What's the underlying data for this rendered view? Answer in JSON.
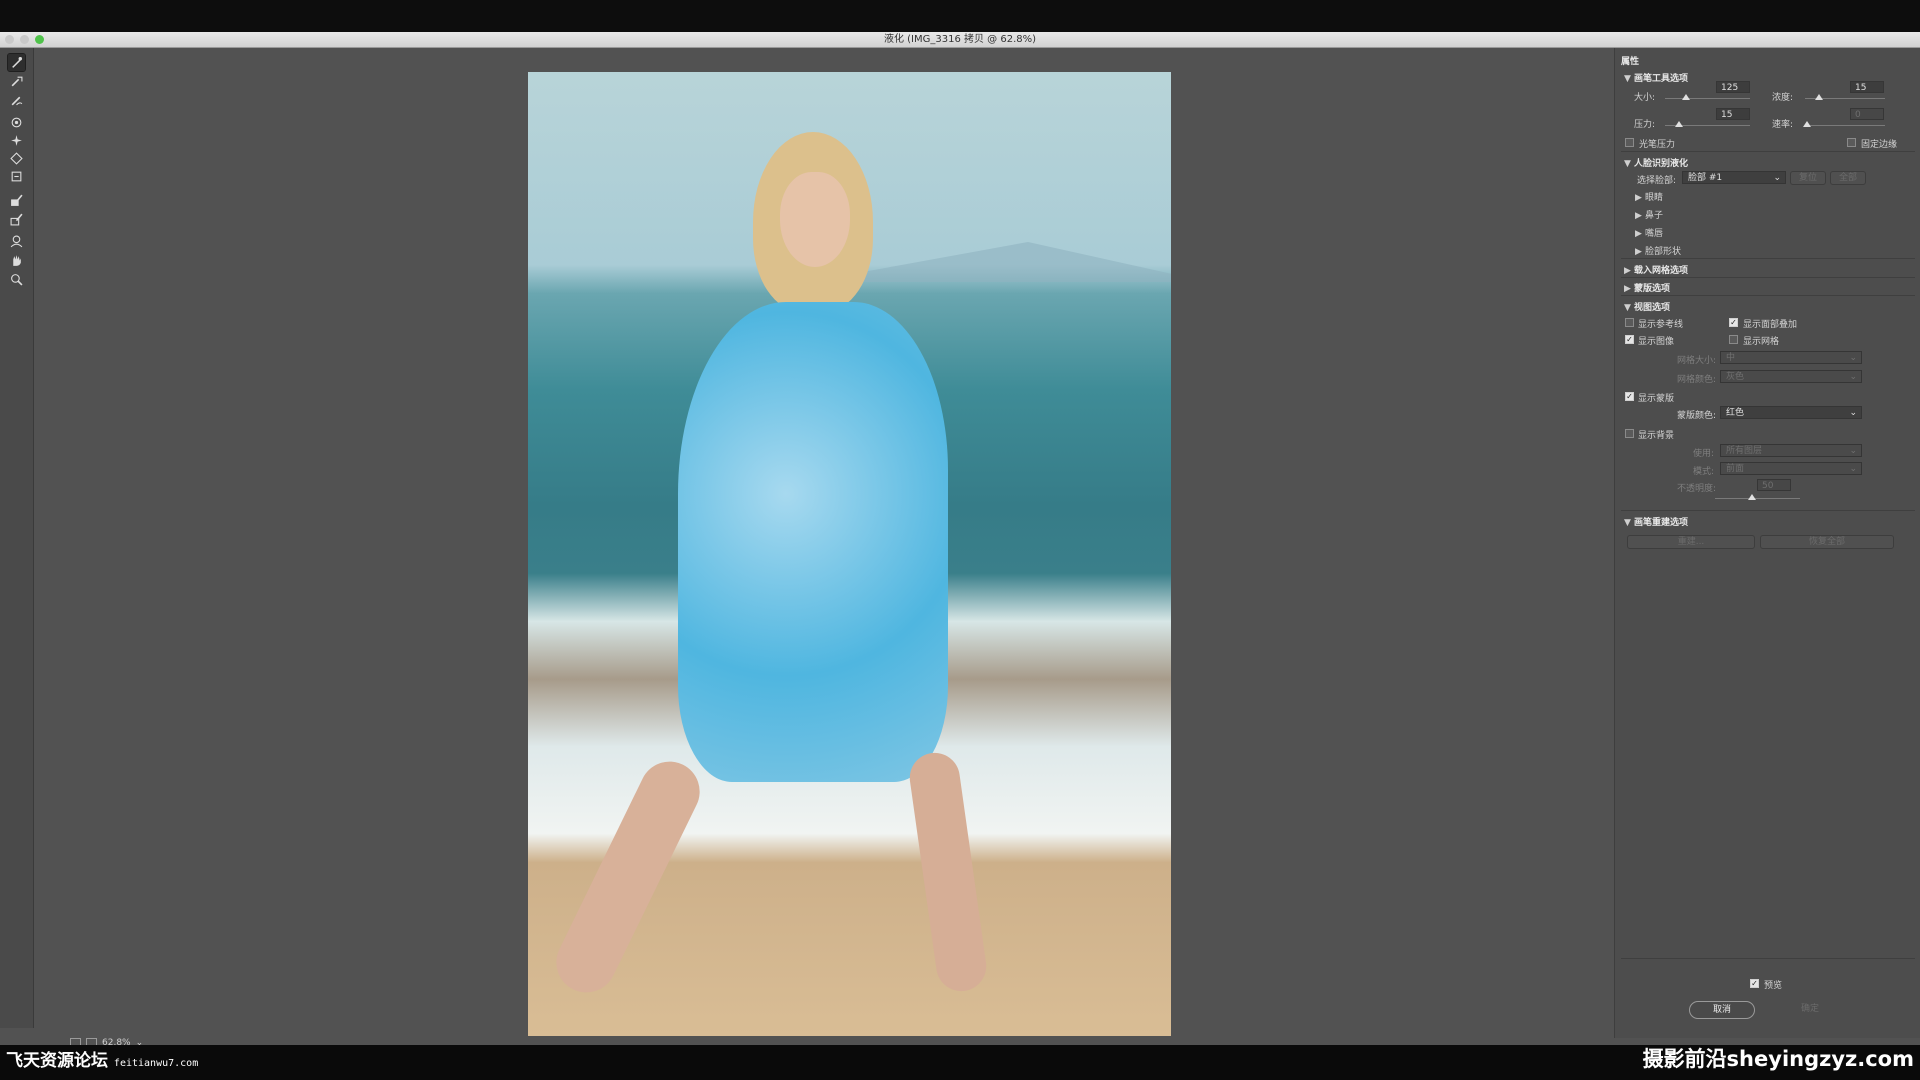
{
  "window": {
    "title": "液化 (IMG_3316 拷贝 @ 62.8%)"
  },
  "toolbar": {
    "tools": [
      "forward-warp-icon",
      "reconstruct-icon",
      "smooth-icon",
      "twirl-icon",
      "pucker-icon",
      "bloat-icon",
      "push-left-icon",
      "freeze-mask-icon",
      "thaw-mask-icon",
      "face-tool-icon",
      "hand-icon",
      "zoom-icon"
    ]
  },
  "status": {
    "zoom": "62.8%"
  },
  "panel": {
    "title": "属性",
    "brush": {
      "header": "画笔工具选项",
      "size_label": "大小:",
      "size_value": "125",
      "density_label": "浓度:",
      "density_value": "15",
      "pressure_label": "压力:",
      "pressure_value": "15",
      "rate_label": "速率:",
      "rate_value": "0",
      "stylus_label": "光笔压力",
      "pin_edges_label": "固定边缘"
    },
    "face": {
      "header": "人脸识别液化",
      "select_label": "选择脸部:",
      "select_value": "脸部 #1",
      "reset_label": "复位",
      "all_label": "全部",
      "sub": [
        "眼睛",
        "鼻子",
        "嘴唇",
        "脸部形状"
      ]
    },
    "load_mesh": {
      "header": "载入网格选项"
    },
    "mask": {
      "header": "蒙版选项"
    },
    "view": {
      "header": "视图选项",
      "show_guides": "显示参考线",
      "show_face_overlay": "显示面部叠加",
      "show_image": "显示图像",
      "show_mesh": "显示网格",
      "mesh_size_label": "网格大小:",
      "mesh_size_value": "中",
      "mesh_color_label": "网格颜色:",
      "mesh_color_value": "灰色",
      "show_mask": "显示蒙版",
      "mask_color_label": "蒙版颜色:",
      "mask_color_value": "红色",
      "show_backdrop": "显示背景",
      "use_label": "使用:",
      "use_value": "所有图层",
      "mode_label": "模式:",
      "mode_value": "前面",
      "opacity_label": "不透明度:",
      "opacity_value": "50"
    },
    "reconstruct": {
      "header": "画笔重建选项",
      "rebuild_label": "重建...",
      "restore_all_label": "恢复全部"
    },
    "preview_label": "预览",
    "cancel_label": "取消",
    "ok_label": "确定"
  },
  "watermarks": {
    "left_title": "飞天资源论坛",
    "left_url": "feitianwu7.com",
    "right": "摄影前沿sheyingzyz.com"
  }
}
